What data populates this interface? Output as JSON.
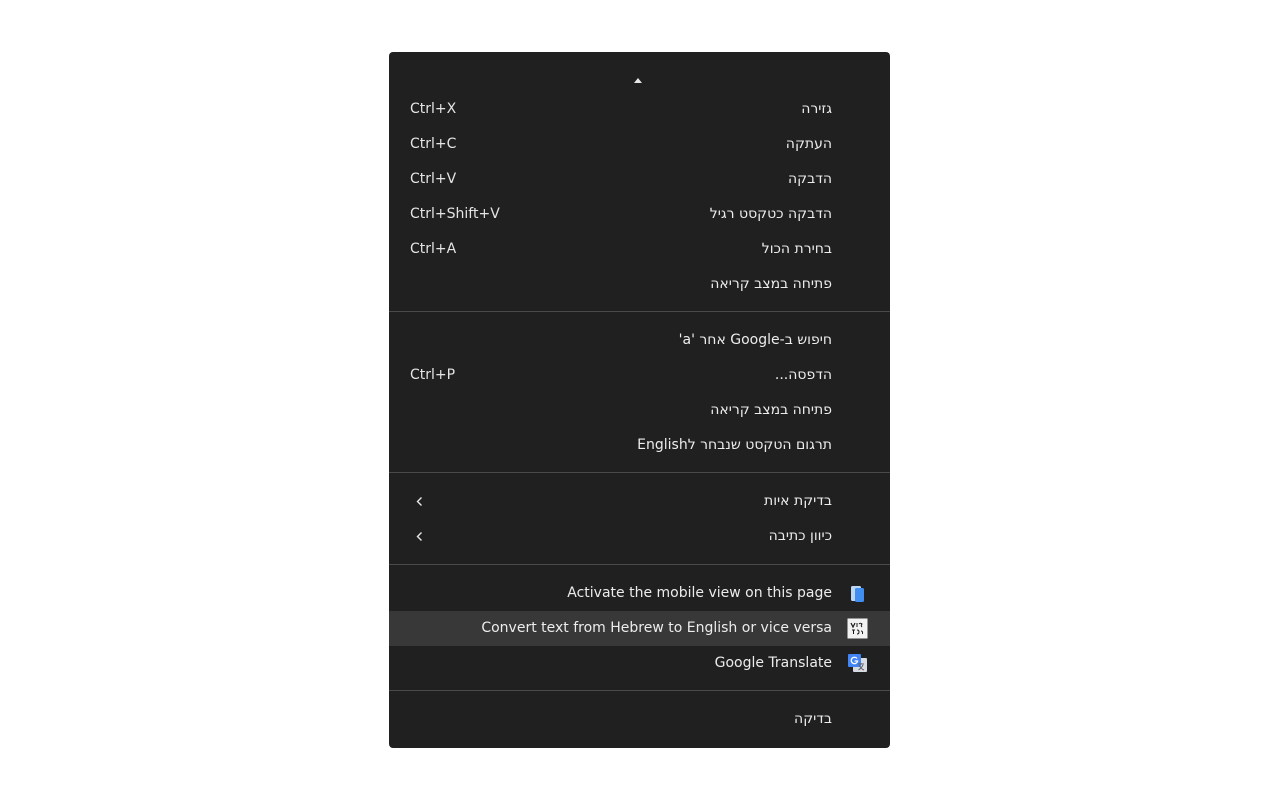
{
  "context_menu": {
    "scroll_up_icon": "chevron-up-icon",
    "groups": [
      {
        "items": [
          {
            "label": "גזירה",
            "shortcut": "Ctrl+X"
          },
          {
            "label": "העתקה",
            "shortcut": "Ctrl+C"
          },
          {
            "label": "הדבקה",
            "shortcut": "Ctrl+V"
          },
          {
            "label": "הדבקה כטקסט רגיל",
            "shortcut": "Ctrl+Shift+V"
          },
          {
            "label": "בחירת הכול",
            "shortcut": "Ctrl+A"
          },
          {
            "label": "פתיחה במצב קריאה",
            "shortcut": ""
          }
        ]
      },
      {
        "items": [
          {
            "label": "חיפוש ב-Google אחר 'a'",
            "shortcut": ""
          },
          {
            "label": "הדפסה...",
            "shortcut": "Ctrl+P"
          },
          {
            "label": "פתיחה במצב קריאה",
            "shortcut": ""
          },
          {
            "label": "תרגום הטקסט שנבחר לEnglish",
            "shortcut": ""
          }
        ]
      },
      {
        "items": [
          {
            "label": "בדיקת איות",
            "submenu": true
          },
          {
            "label": "כיוון כתיבה",
            "submenu": true
          }
        ]
      },
      {
        "items": [
          {
            "label": "Activate the mobile view on this page",
            "icon": "mobile-view-extension-icon"
          },
          {
            "label": "Convert text from Hebrew to English or vice versa",
            "icon": "vice-versa-extension-icon",
            "highlighted": true
          },
          {
            "label": "Google Translate",
            "icon": "google-translate-icon"
          }
        ]
      },
      {
        "items": [
          {
            "label": "בדיקה",
            "shortcut": ""
          }
        ]
      }
    ],
    "colors": {
      "background": "#202020",
      "text": "#ececec",
      "highlight": "#383838",
      "separator": "#4a4a4a"
    }
  }
}
